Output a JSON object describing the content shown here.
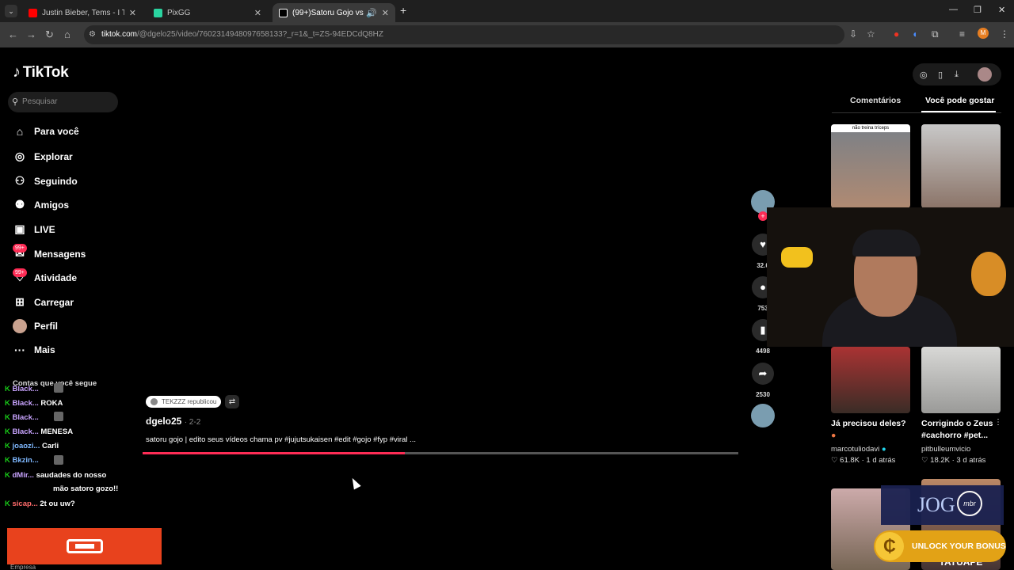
{
  "browser": {
    "tabs": [
      {
        "title": "Justin Bieber, Tems - I THINK YO",
        "color": "#ff0000"
      },
      {
        "title": "PixGG",
        "color": "#2ad4a0"
      },
      {
        "title": "(99+)Satoru Gojo vs Sukuna",
        "color": "#ffffff"
      }
    ],
    "url_host": "tiktok.com",
    "url_rest": "/@dgelo25/video/7602314948097658133?_r=1&_t=ZS-94EDCdQ8HZ"
  },
  "tiktok": {
    "logo": "TikTok",
    "search_placeholder": "Pesquisar",
    "nav": [
      {
        "label": "Para você",
        "icon": "home-icon"
      },
      {
        "label": "Explorar",
        "icon": "compass-icon"
      },
      {
        "label": "Seguindo",
        "icon": "following-icon"
      },
      {
        "label": "Amigos",
        "icon": "friends-icon"
      },
      {
        "label": "LIVE",
        "icon": "live-icon"
      },
      {
        "label": "Mensagens",
        "icon": "messages-icon"
      },
      {
        "label": "Atividade",
        "icon": "activity-icon"
      },
      {
        "label": "Carregar",
        "icon": "upload-icon"
      },
      {
        "label": "Perfil",
        "icon": "profile-avatar"
      },
      {
        "label": "Mais",
        "icon": "more-icon"
      }
    ],
    "badges": {
      "messages": "99+",
      "activity": "99+"
    },
    "following_header": "Contas que você segue"
  },
  "video": {
    "tag": "TEKZZZ republicou",
    "author": "dgelo25",
    "date": "· 2-2",
    "caption": "satoru gojo | edito seus vídeos chama pv #jujutsukaisen #edit #gojo #fyp #viral ...",
    "progress": 0.44,
    "likes": "32.6",
    "comments": "753",
    "saves": "4498",
    "shares": "2530"
  },
  "right_panel": {
    "tab_comments": "Comentários",
    "tab_recommend": "Você pode gostar",
    "thumb1_text": "não treina tríceps",
    "recs": [
      {
        "title": "Já precisou deles?",
        "user": "marcotuliodavi",
        "stats": "61.8K · 1 d atrás"
      },
      {
        "title": "Corrigindo o Zeus #cachorro #pet...",
        "user": "pitbulleumvicio",
        "stats": "18.2K · 3 d atrás"
      }
    ],
    "bottom_thumb_text": "TATUAPÉ"
  },
  "chat": [
    {
      "name": "Black...",
      "msg": ""
    },
    {
      "name": "Black...",
      "msg": "ROKA"
    },
    {
      "name": "Black...",
      "msg": ""
    },
    {
      "name": "Black...",
      "msg": "MENESA"
    },
    {
      "name": "joaozi...",
      "msg": "Carli"
    },
    {
      "name": "Bkzin...",
      "msg": ""
    },
    {
      "name": "dMir...",
      "msg": "saudades do nosso"
    },
    {
      "name": "",
      "msg": "mão satoro gozo!!"
    },
    {
      "name": "sicap...",
      "msg": "2t ou uw?"
    }
  ],
  "overlay": {
    "bonus": "UNLOCK YOUR BONUS",
    "mbr_text": "JOG",
    "mbr_badge": "mbr",
    "empresa": "Empresa"
  }
}
